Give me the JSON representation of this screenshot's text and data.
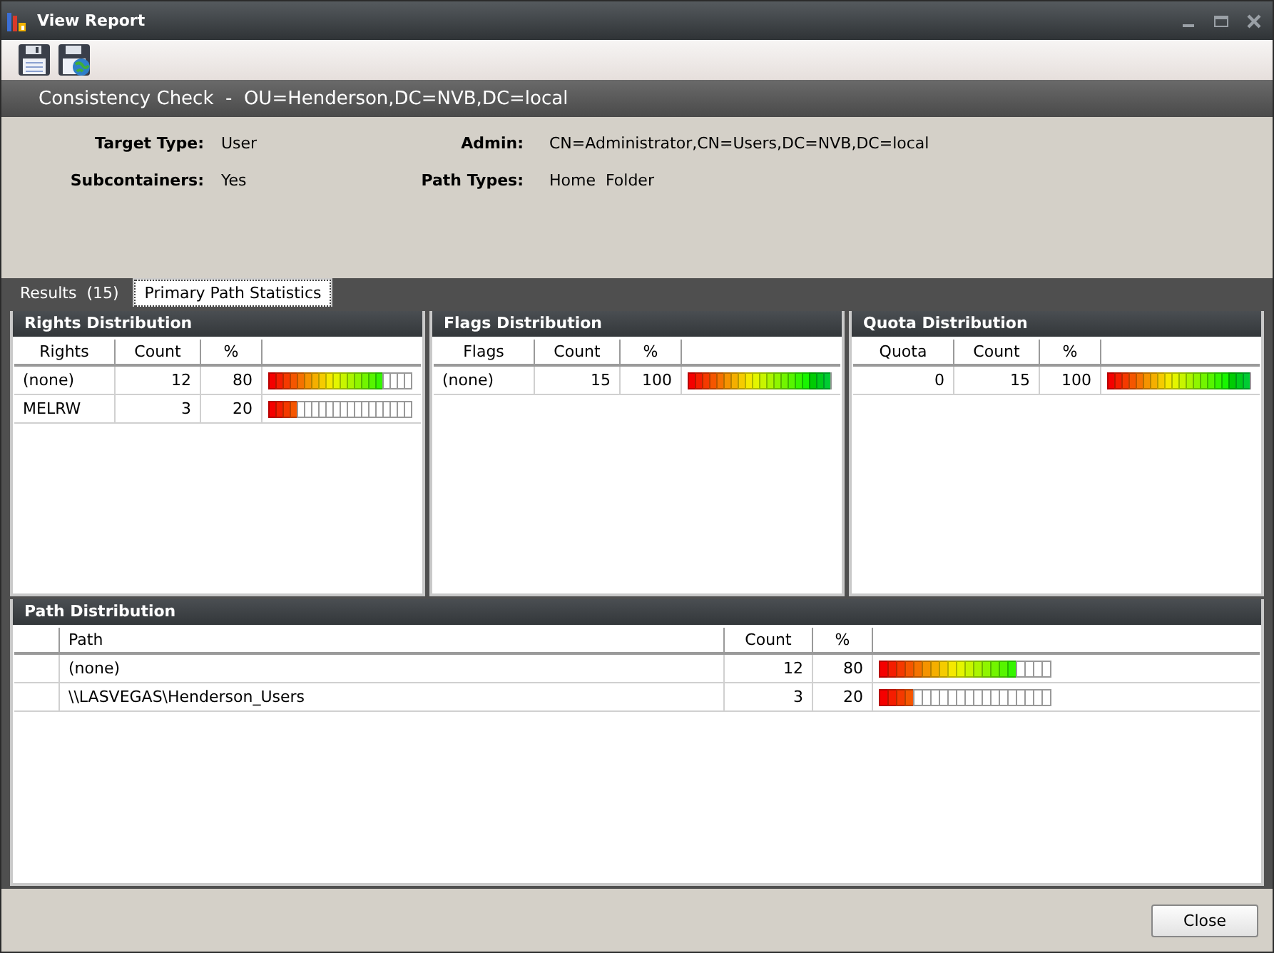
{
  "window": {
    "title": "View Report"
  },
  "header": {
    "title": "Consistency Check  -  OU=Henderson,DC=NVB,DC=local"
  },
  "info": [
    {
      "label": "Target Type:",
      "value": "User"
    },
    {
      "label": "Admin:",
      "value": "CN=Administrator,CN=Users,DC=NVB,DC=local"
    },
    {
      "label": "Subcontainers:",
      "value": "Yes"
    },
    {
      "label": "Path Types:",
      "value": "Home  Folder"
    }
  ],
  "tabs": [
    {
      "label": "Results  (15)",
      "selected": false
    },
    {
      "label": "Primary Path Statistics",
      "selected": true
    }
  ],
  "panels": [
    {
      "title": "Rights Distribution",
      "kind": "small",
      "columns": [
        "Rights",
        "Count",
        "%"
      ],
      "rows": [
        {
          "cells": [
            "(none)",
            "12",
            "80"
          ],
          "level": 0.8
        },
        {
          "cells": [
            "MELRW",
            "3",
            "20"
          ],
          "level": 0.2
        }
      ]
    },
    {
      "title": "Flags Distribution",
      "kind": "small",
      "columns": [
        "Flags",
        "Count",
        "%"
      ],
      "rows": [
        {
          "cells": [
            "(none)",
            "15",
            "100"
          ],
          "level": 1
        }
      ]
    },
    {
      "title": "Quota Distribution",
      "kind": "small",
      "columns": [
        "Quota",
        "Count",
        "%"
      ],
      "rows": [
        {
          "cells": [
            "0",
            "15",
            "100"
          ],
          "level": 1
        }
      ]
    },
    {
      "title": "Path Distribution",
      "kind": "indexed",
      "columns": [
        "Path",
        "Count",
        "%"
      ],
      "rows": [
        {
          "cells": [
            "(none)",
            "12",
            "80"
          ],
          "level": 0.8
        },
        {
          "cells": [
            "\\\\LASVEGAS\\Henderson_Users",
            "3",
            "20"
          ],
          "level": 0.2
        }
      ]
    }
  ],
  "buttons": [
    "Close"
  ]
}
